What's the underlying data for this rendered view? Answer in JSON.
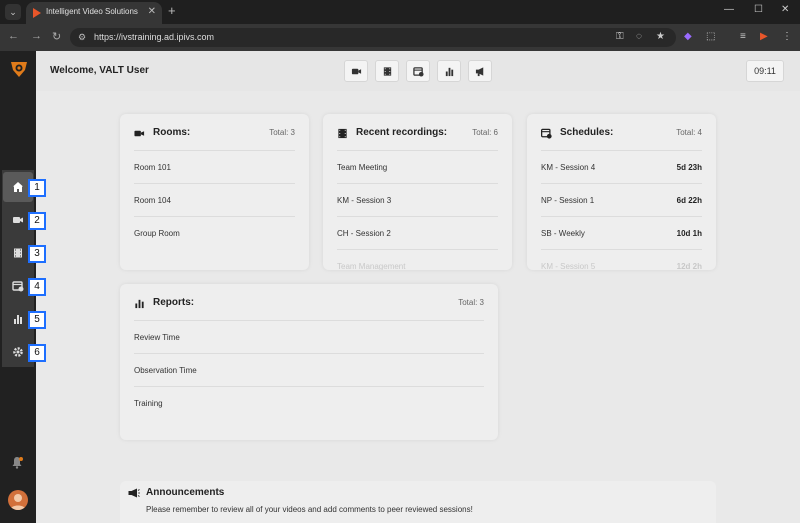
{
  "browser": {
    "tab_title": "Intelligent Video Solutions",
    "url": "https://ivstraining.ad.ipivs.com"
  },
  "header": {
    "welcome": "Welcome, VALT User",
    "clock": "09:11"
  },
  "sidebar": {
    "badges": [
      "1",
      "2",
      "3",
      "4",
      "5",
      "6"
    ]
  },
  "rooms": {
    "title": "Rooms:",
    "total": "Total: 3",
    "items": [
      "Room 101",
      "Room 104",
      "Group Room"
    ]
  },
  "recordings": {
    "title": "Recent recordings:",
    "total": "Total: 6",
    "items": [
      "Team Meeting",
      "KM - Session 3",
      "CH - Session 2",
      "Team Management"
    ]
  },
  "schedules": {
    "title": "Schedules:",
    "total": "Total: 4",
    "items": [
      {
        "label": "KM - Session 4",
        "value": "5d 23h"
      },
      {
        "label": "NP - Session 1",
        "value": "6d 22h"
      },
      {
        "label": "SB - Weekly",
        "value": "10d 1h"
      },
      {
        "label": "KM - Session 5",
        "value": "12d 2h"
      }
    ]
  },
  "reports": {
    "title": "Reports:",
    "total": "Total: 3",
    "items": [
      "Review Time",
      "Observation Time",
      "Training"
    ]
  },
  "announcements": {
    "title": "Announcements",
    "text": "Please remember to review all of your videos and add comments to peer reviewed sessions!"
  },
  "colors": {
    "sidebar_bg": "#212121",
    "badge_border": "#1e6fff",
    "brand_orange": "#e07b1a"
  }
}
